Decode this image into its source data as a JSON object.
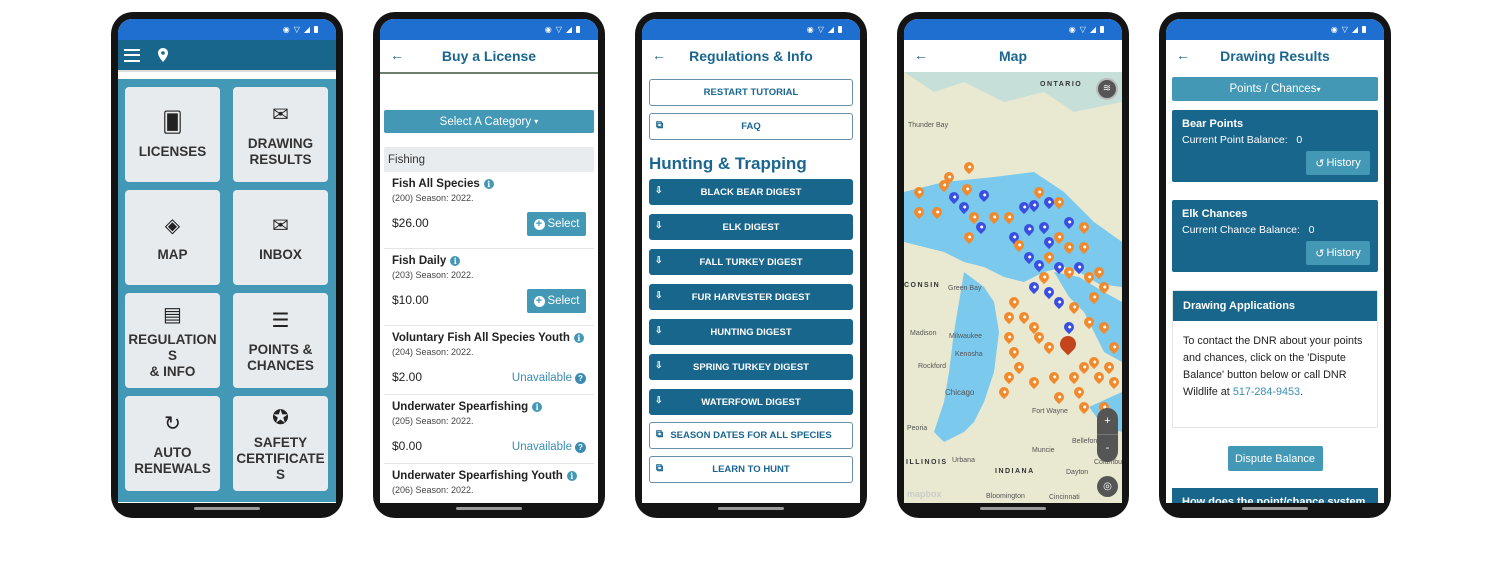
{
  "status_bar": {
    "icons": [
      "eye-icon",
      "wifi-icon",
      "signal-icon",
      "battery-icon"
    ],
    "network": "4G"
  },
  "colors": {
    "primary": "#19668c",
    "accent": "#4298b5",
    "status_bar": "#1e6fcf",
    "orange_marker": "#f08a2c",
    "blue_marker": "#3a4fe0",
    "selected_marker": "#c4441c"
  },
  "home": {
    "header_icons": [
      "menu-icon",
      "location-pin-icon"
    ],
    "tiles": [
      {
        "icon": "credit-card-hand-icon",
        "label": "LICENSES"
      },
      {
        "icon": "envelope-open-icon",
        "label": "DRAWING\nRESULTS"
      },
      {
        "icon": "map-icon",
        "label": "MAP"
      },
      {
        "icon": "messages-icon",
        "label": "INBOX"
      },
      {
        "icon": "documents-icon",
        "label": "REGULATION\nS\n& INFO"
      },
      {
        "icon": "list-icon",
        "label": "POINTS &\nCHANCES"
      },
      {
        "icon": "refresh-icon",
        "label": "AUTO\nRENEWALS"
      },
      {
        "icon": "award-icon",
        "label": "SAFETY\nCERTIFICATE\nS"
      }
    ]
  },
  "buy_license": {
    "title": "Buy a License",
    "category_button": "Select A Category",
    "category_header": "Fishing",
    "select_label": "Select",
    "unavailable_label": "Unavailable",
    "licenses": [
      {
        "name": "Fish All Species",
        "season": "(200) Season: 2022.",
        "price": "$26.00",
        "available": true
      },
      {
        "name": "Fish Daily",
        "season": "(203) Season: 2022.",
        "price": "$10.00",
        "available": true
      },
      {
        "name": "Voluntary Fish All Species Youth",
        "season": "(204) Season: 2022.",
        "price": "$2.00",
        "available": false
      },
      {
        "name": "Underwater Spearfishing",
        "season": "(205) Season: 2022.",
        "price": "$0.00",
        "available": false
      },
      {
        "name": "Underwater Spearfishing Youth",
        "season": "(206) Season: 2022.",
        "price": "",
        "available": null
      }
    ]
  },
  "regulations": {
    "title": "Regulations & Info",
    "restart_tutorial": "RESTART TUTORIAL",
    "faq": "FAQ",
    "section_title": "Hunting & Trapping",
    "digests": [
      "BLACK BEAR DIGEST",
      "ELK DIGEST",
      "FALL TURKEY DIGEST",
      "FUR HARVESTER DIGEST",
      "HUNTING DIGEST",
      "SPRING TURKEY DIGEST",
      "WATERFOWL DIGEST"
    ],
    "links": [
      "SEASON DATES FOR ALL SPECIES",
      "LEARN TO HUNT"
    ]
  },
  "map": {
    "title": "Map",
    "labels": {
      "ontario": "ONTARIO",
      "thunder_bay": "Thunder Bay",
      "wisconsin": "CONSIN",
      "green_bay": "Green Bay",
      "madison": "Madison",
      "milwaukee": "Milwaukee",
      "kenosha": "Kenosha",
      "rockford": "Rockford",
      "chicago": "Chicago",
      "fort_wayne": "Fort Wayne",
      "peoria": "Peoria",
      "bellefontaine": "Bellefontai",
      "illinois": "ILLINOIS",
      "urbana": "Urbana",
      "muncie": "Muncie",
      "columbus": "Columbus",
      "indiana": "INDIANA",
      "dayton": "Dayton",
      "bloomington": "Bloomington",
      "cincinnati": "Cincinnati"
    },
    "zoom_in": "+",
    "zoom_out": "-",
    "attribution": "mapbox"
  },
  "drawing": {
    "title": "Drawing Results",
    "filter_button": "Points / Chances",
    "cards": [
      {
        "title": "Bear Points",
        "balance_label": "Current Point Balance:",
        "balance": "0",
        "history": "History"
      },
      {
        "title": "Elk Chances",
        "balance_label": "Current Chance Balance:",
        "balance": "0",
        "history": "History"
      }
    ],
    "applications_title": "Drawing Applications",
    "applications_text": "To contact the DNR about your points and chances, click on the 'Dispute Balance' button below or call DNR Wildlife at ",
    "phone": "517-284-9453",
    "dispute_button": "Dispute Balance",
    "how_title": "How does the point/chance system"
  }
}
